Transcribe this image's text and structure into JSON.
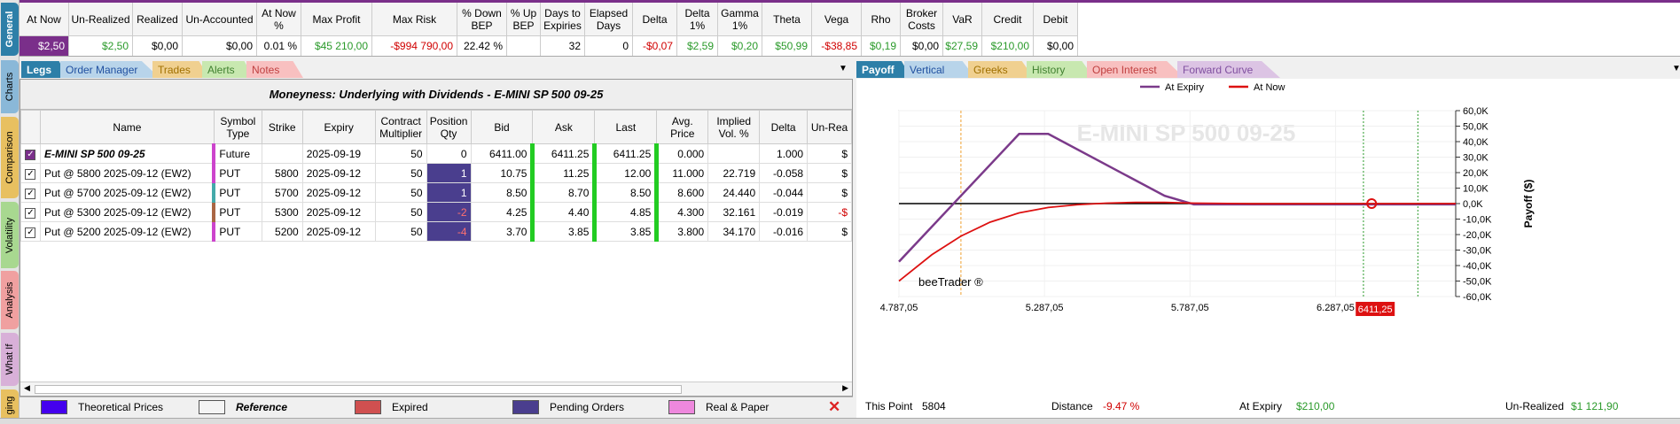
{
  "vertical_tabs": [
    "General",
    "Charts",
    "Comparison",
    "Volatility",
    "Analysis",
    "What If",
    "ging"
  ],
  "summary": {
    "headers": [
      "At Now",
      "Un-Realized",
      "Realized",
      "Un-Accounted",
      "At Now %",
      "Max Profit",
      "Max Risk",
      "% Down BEP",
      "% Up BEP",
      "Days to Expiries",
      "Elapsed Days",
      "Delta",
      "Delta 1%",
      "Gamma 1%",
      "Theta",
      "Vega",
      "Rho",
      "Broker Costs",
      "VaR",
      "Credit",
      "Debit"
    ],
    "values": [
      "$2,50",
      "$2,50",
      "$0,00",
      "$0,00",
      "0.01 %",
      "$45 210,00",
      "-$994 790,00",
      "22.42 %",
      "",
      "32",
      "0",
      "-$0,07",
      "$2,59",
      "$0,20",
      "$50,99",
      "-$38,85",
      "$0,19",
      "$0,00",
      "$27,59",
      "$210,00",
      "$0,00"
    ]
  },
  "left_tabs": [
    "Legs",
    "Order Manager",
    "Trades",
    "Alerts",
    "Notes"
  ],
  "right_tabs": [
    "Payoff",
    "Vertical",
    "Greeks",
    "History",
    "Open Interest",
    "Forward Curve"
  ],
  "legs": {
    "title": "Moneyness: Underlying with Dividends - E-MINI SP 500 09-25",
    "columns": [
      "Name",
      "Symbol Type",
      "Strike",
      "Expiry",
      "Contract Multiplier",
      "Position Qty",
      "Bid",
      "Ask",
      "Last",
      "Avg. Price",
      "Implied Vol. %",
      "Delta",
      "Un-Rea"
    ],
    "rows": [
      {
        "name": "E-MINI SP 500 09-25",
        "type": "Future",
        "strike": "",
        "expiry": "2025-09-19",
        "mult": "50",
        "qty": "0",
        "bid": "6411.00",
        "ask": "6411.25",
        "last": "6411.25",
        "avg": "0.000",
        "iv": "",
        "delta": "1.000",
        "unreal": "$"
      },
      {
        "name": "Put @ 5800 2025-09-12 (EW2)",
        "type": "PUT",
        "strike": "5800",
        "expiry": "2025-09-12",
        "mult": "50",
        "qty": "1",
        "bid": "10.75",
        "ask": "11.25",
        "last": "12.00",
        "avg": "11.000",
        "iv": "22.719",
        "delta": "-0.058",
        "unreal": "$"
      },
      {
        "name": "Put @ 5700 2025-09-12 (EW2)",
        "type": "PUT",
        "strike": "5700",
        "expiry": "2025-09-12",
        "mult": "50",
        "qty": "1",
        "bid": "8.50",
        "ask": "8.70",
        "last": "8.50",
        "avg": "8.600",
        "iv": "24.440",
        "delta": "-0.044",
        "unreal": "$"
      },
      {
        "name": "Put @ 5300 2025-09-12 (EW2)",
        "type": "PUT",
        "strike": "5300",
        "expiry": "2025-09-12",
        "mult": "50",
        "qty": "-2",
        "bid": "4.25",
        "ask": "4.40",
        "last": "4.85",
        "avg": "4.300",
        "iv": "32.161",
        "delta": "-0.019",
        "unreal": "-$"
      },
      {
        "name": "Put @ 5200 2025-09-12 (EW2)",
        "type": "PUT",
        "strike": "5200",
        "expiry": "2025-09-12",
        "mult": "50",
        "qty": "-4",
        "bid": "3.70",
        "ask": "3.85",
        "last": "3.85",
        "avg": "3.800",
        "iv": "34.170",
        "delta": "-0.016",
        "unreal": "$"
      }
    ]
  },
  "legend_bar": [
    "Theoretical Prices",
    "Reference",
    "Expired",
    "Pending Orders",
    "Real & Paper"
  ],
  "payoff": {
    "legend": [
      "At Expiry",
      "At Now"
    ],
    "watermark": "E-MINI SP 500 09-25",
    "brand": "beeTrader ®",
    "ylabel": "Payoff ($)",
    "x_ticks": [
      "4.787,05",
      "5.287,05",
      "5.787,05",
      "6.287,05"
    ],
    "current_price_label": "6411,25",
    "y_ticks": [
      "60,0K",
      "50,0K",
      "40,0K",
      "30,0K",
      "20,0K",
      "10,0K",
      "0,0K",
      "-10,0K",
      "-20,0K",
      "-30,0K",
      "-40,0K",
      "-50,0K",
      "-60,0K"
    ]
  },
  "chart_data": {
    "type": "line",
    "xlim": [
      4787.05,
      6700
    ],
    "ylim": [
      -60000,
      60000
    ],
    "ylabel": "Payoff ($)",
    "series": [
      {
        "name": "At Expiry",
        "color": "#7b3a8a",
        "x": [
          4787.05,
          5200,
          5300,
          5700,
          5800,
          6700
        ],
        "y": [
          -37500,
          45000,
          45000,
          5000,
          -500,
          -500
        ]
      },
      {
        "name": "At Now",
        "color": "#dd1111",
        "x": [
          4787.05,
          4900,
          5000,
          5100,
          5200,
          5300,
          5400,
          5500,
          5600,
          5700,
          5800,
          6000,
          6700
        ],
        "y": [
          -50000,
          -33000,
          -21000,
          -12000,
          -6000,
          -2500,
          -700,
          300,
          800,
          800,
          300,
          -100,
          0
        ]
      }
    ]
  },
  "bottom_info": {
    "this_point_label": "This Point",
    "this_point": "5804",
    "distance_label": "Distance",
    "distance": "-9.47 %",
    "at_expiry_label": "At Expiry",
    "at_expiry": "$210,00",
    "unrealized_label": "Un-Realized",
    "unrealized": "$1 121,90"
  },
  "colors": {
    "accent": "#7a2f8a",
    "green": "#22cc22",
    "pending": "#4a3e8e",
    "negative": "#d00000",
    "positive": "#2a9a2a"
  }
}
